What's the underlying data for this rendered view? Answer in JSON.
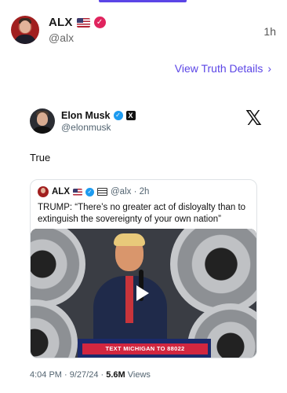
{
  "post": {
    "display_name": "ALX",
    "handle": "@alx",
    "time": "1h",
    "view_details": "View Truth Details",
    "view_details_chevron": "›"
  },
  "embed": {
    "author_name": "Elon Musk",
    "author_handle": "@elonmusk",
    "x_logo": "𝕏",
    "text": "True",
    "quote": {
      "name": "ALX",
      "handle_time": "@alx · 2h",
      "text": "TRUMP: “There’s no greater act of disloyalty than to extinguish the sovereignty of your own nation”",
      "video_sign": "TEXT MICHIGAN TO 88022"
    },
    "meta": {
      "time_date": "4:04 PM · 9/27/24 · ",
      "views_count": "5.6M",
      "views_label": " Views"
    }
  },
  "colors": {
    "accent": "#5b45e6",
    "verified_red": "#e0245e",
    "verified_blue": "#1d9bf0"
  }
}
